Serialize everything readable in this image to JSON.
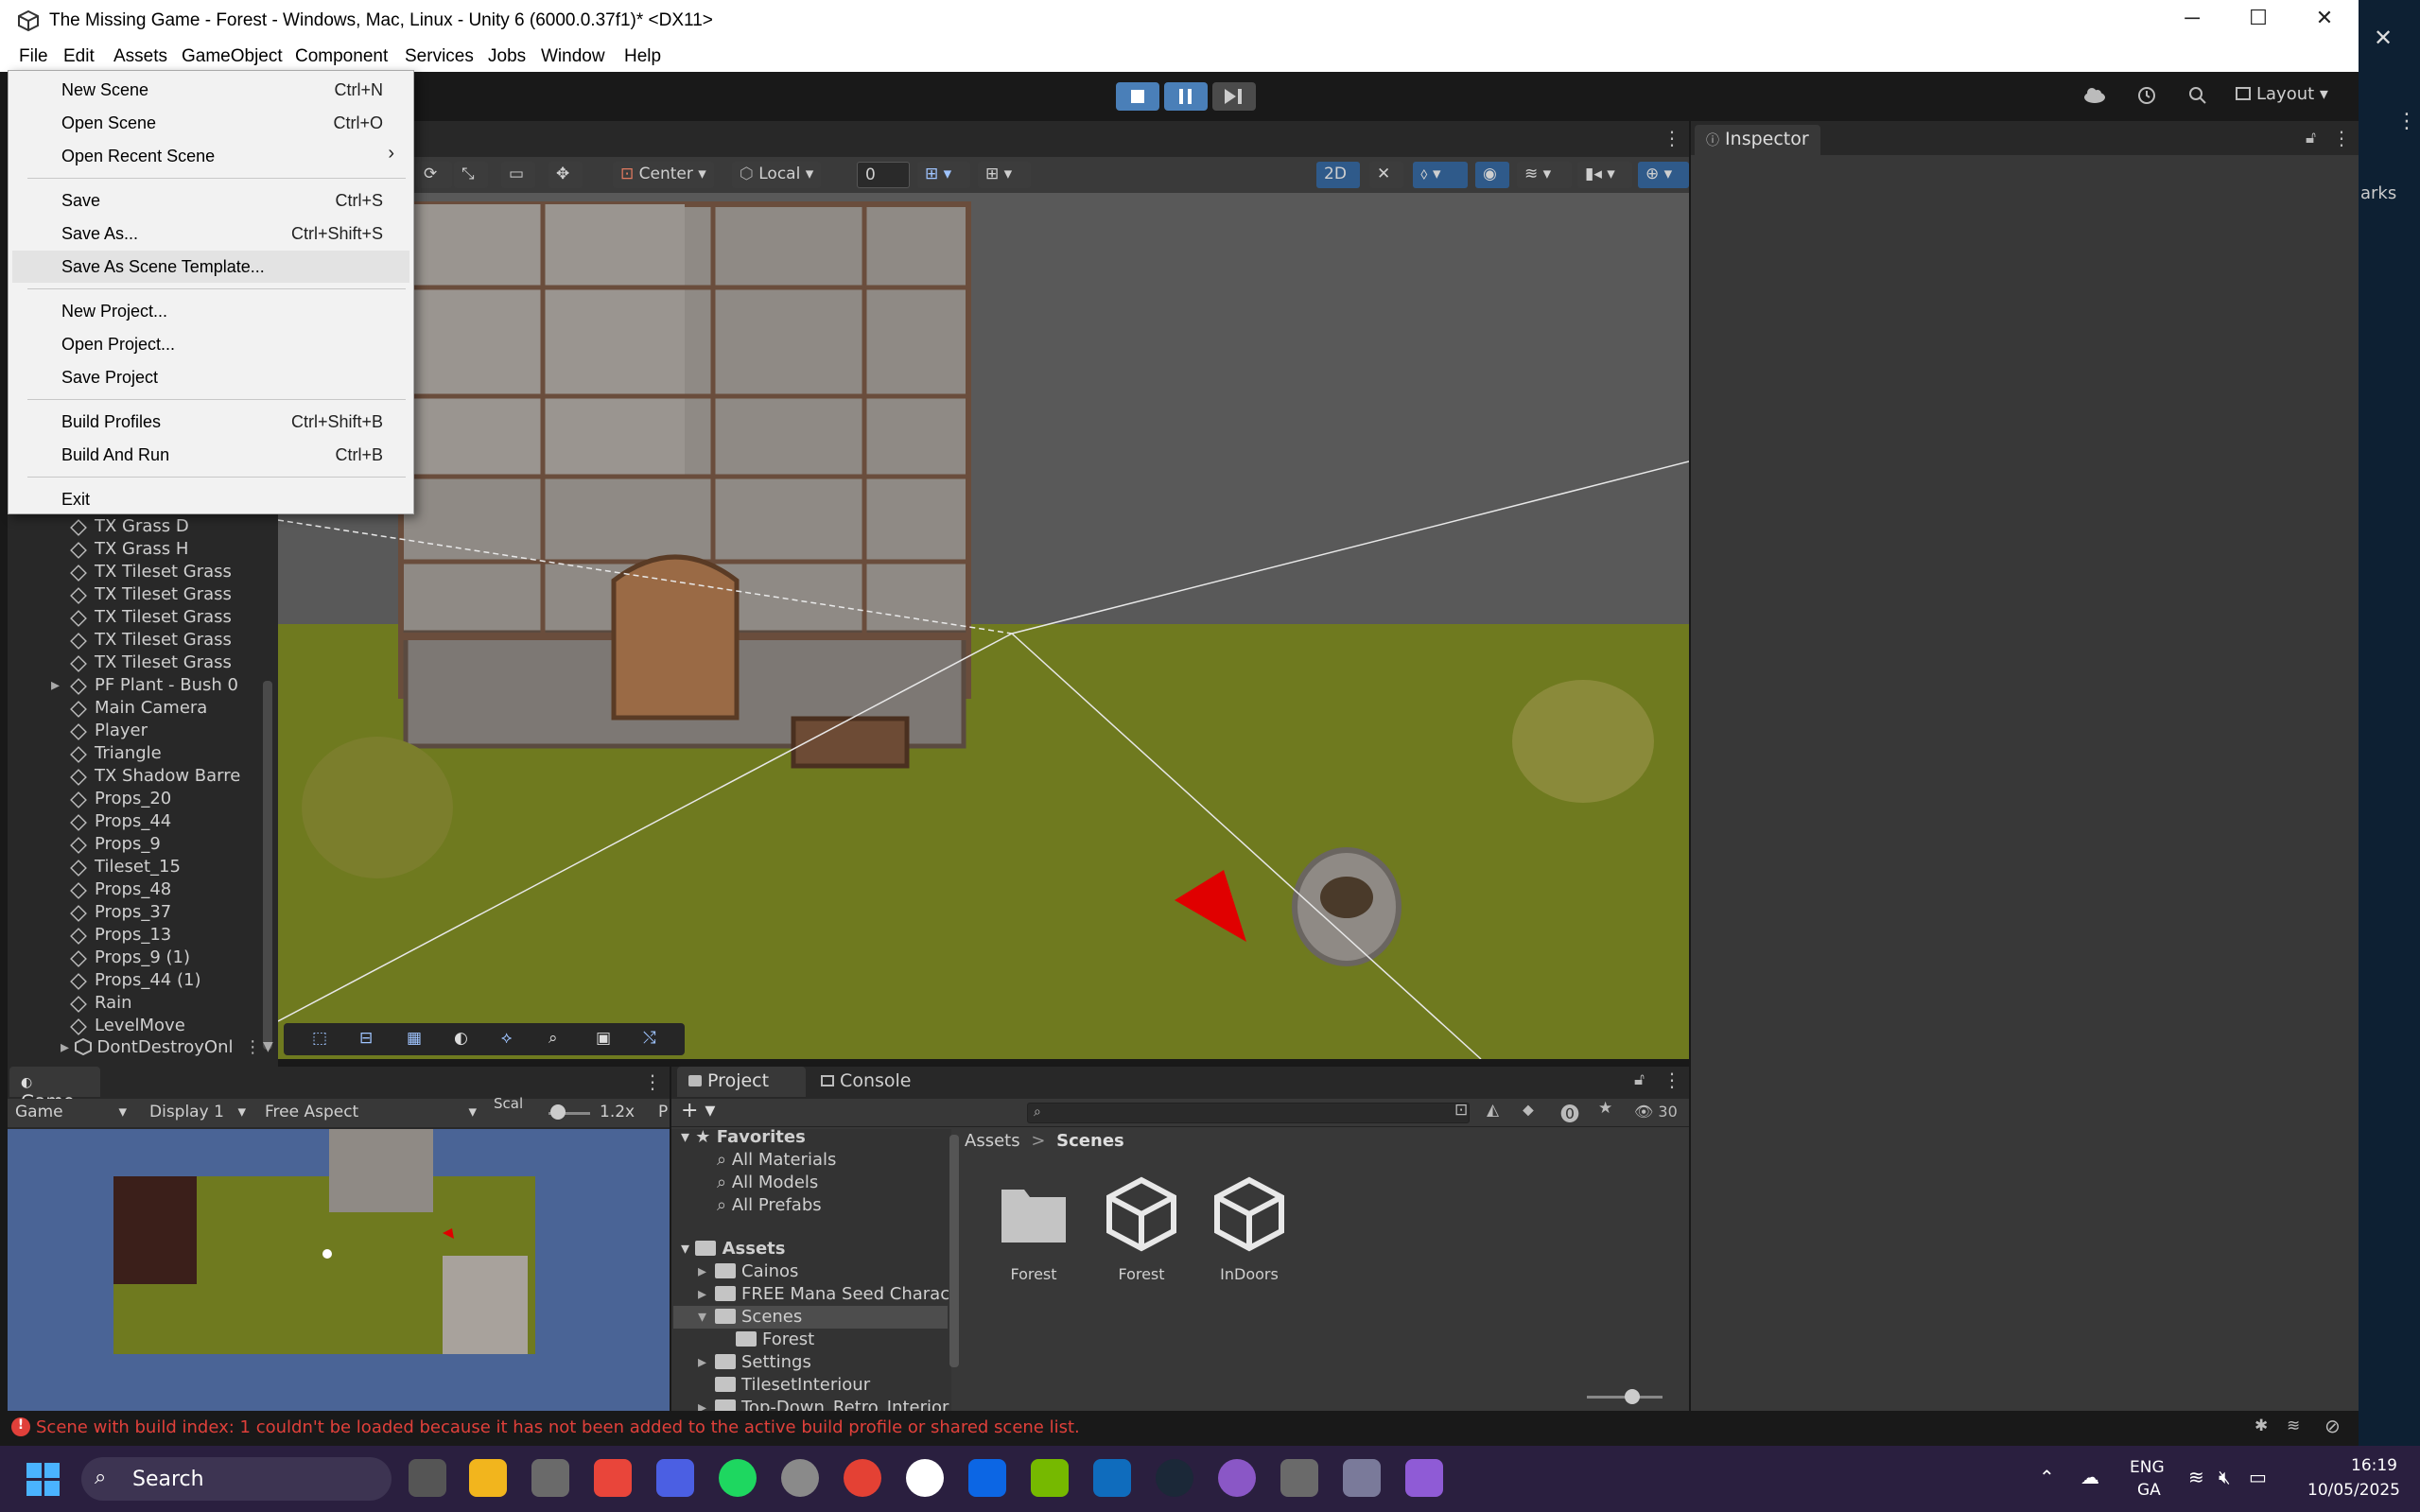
{
  "window": {
    "title": "The Missing Game - Forest - Windows, Mac, Linux - Unity 6 (6000.0.37f1)* <DX11>",
    "minimize": "─",
    "maximize": "☐",
    "close": "✕"
  },
  "menubar": [
    "File",
    "Edit",
    "Assets",
    "GameObject",
    "Component",
    "Services",
    "Jobs",
    "Window",
    "Help"
  ],
  "file_menu": [
    {
      "label": "New Scene",
      "shortcut": "Ctrl+N"
    },
    {
      "label": "Open Scene",
      "shortcut": "Ctrl+O"
    },
    {
      "label": "Open Recent Scene",
      "shortcut": "›"
    },
    {
      "label": "Save",
      "shortcut": "Ctrl+S"
    },
    {
      "label": "Save As...",
      "shortcut": "Ctrl+Shift+S"
    },
    {
      "label": "Save As Scene Template...",
      "shortcut": ""
    },
    {
      "label": "New Project...",
      "shortcut": ""
    },
    {
      "label": "Open Project...",
      "shortcut": ""
    },
    {
      "label": "Save Project",
      "shortcut": ""
    },
    {
      "label": "Build Profiles",
      "shortcut": "Ctrl+Shift+B"
    },
    {
      "label": "Build And Run",
      "shortcut": "Ctrl+B"
    },
    {
      "label": "Exit",
      "shortcut": ""
    }
  ],
  "toolbar": {
    "layout_label": "Layout"
  },
  "scene_toolbar": {
    "pivot": "Center",
    "space": "Local",
    "snap_value": "0",
    "mode_2d": "2D"
  },
  "inspector": {
    "tab": "Inspector"
  },
  "hierarchy": {
    "items": [
      {
        "label": "TX Grass D",
        "expandable": false
      },
      {
        "label": "TX Grass H",
        "expandable": false
      },
      {
        "label": "TX Tileset Grass",
        "expandable": false
      },
      {
        "label": "TX Tileset Grass",
        "expandable": false
      },
      {
        "label": "TX Tileset Grass",
        "expandable": false
      },
      {
        "label": "TX Tileset Grass",
        "expandable": false
      },
      {
        "label": "TX Tileset Grass",
        "expandable": false
      },
      {
        "label": "PF Plant - Bush 0",
        "expandable": true
      },
      {
        "label": "Main Camera",
        "expandable": false
      },
      {
        "label": "Player",
        "expandable": false
      },
      {
        "label": "Triangle",
        "expandable": false
      },
      {
        "label": "TX Shadow Barre",
        "expandable": false
      },
      {
        "label": "Props_20",
        "expandable": false
      },
      {
        "label": "Props_44",
        "expandable": false
      },
      {
        "label": "Props_9",
        "expandable": false
      },
      {
        "label": "Tileset_15",
        "expandable": false
      },
      {
        "label": "Props_48",
        "expandable": false
      },
      {
        "label": "Props_37",
        "expandable": false
      },
      {
        "label": "Props_13",
        "expandable": false
      },
      {
        "label": "Props_9 (1)",
        "expandable": false
      },
      {
        "label": "Props_44 (1)",
        "expandable": false
      },
      {
        "label": "Rain",
        "expandable": false
      },
      {
        "label": "LevelMove",
        "expandable": false
      }
    ],
    "dontdestroy": "DontDestroyOnl"
  },
  "game_view": {
    "tab": "Game",
    "mode": "Game",
    "display": "Display 1",
    "aspect": "Free Aspect",
    "scale_label": "Scal",
    "scale_value": "1.2x",
    "extra": "P"
  },
  "project": {
    "tab_project": "Project",
    "tab_console": "Console",
    "hidden_count": "30",
    "favorites": {
      "label": "Favorites",
      "items": [
        "All Materials",
        "All Models",
        "All Prefabs"
      ]
    },
    "assets_label": "Assets",
    "assets_tree": [
      {
        "label": "Cainos",
        "indent": 1,
        "expandable": true
      },
      {
        "label": "FREE Mana Seed Charact",
        "indent": 1,
        "expandable": true
      },
      {
        "label": "Scenes",
        "indent": 1,
        "expandable": true,
        "selected": true
      },
      {
        "label": "Forest",
        "indent": 2,
        "expandable": false
      },
      {
        "label": "Settings",
        "indent": 1,
        "expandable": true
      },
      {
        "label": "TilesetInteriour",
        "indent": 1,
        "expandable": false
      },
      {
        "label": "Top-Down_Retro_Interior",
        "indent": 1,
        "expandable": true
      }
    ],
    "breadcrumb": [
      "Assets",
      "Scenes"
    ],
    "breadcrumb_sep": ">",
    "grid": [
      {
        "label": "Forest",
        "kind": "folder"
      },
      {
        "label": "Forest",
        "kind": "scene"
      },
      {
        "label": "InDoors",
        "kind": "scene"
      }
    ]
  },
  "status_bar": {
    "message": "Scene with build index: 1 couldn't be loaded because it has not been added to the active build profile or shared scene list."
  },
  "right_edge": {
    "text": "arks"
  },
  "taskbar": {
    "search": "Search",
    "lang_1": "ENG",
    "lang_2": "GA",
    "time": "16:19",
    "date": "10/05/2025"
  },
  "colors": {
    "accent_blue": "#4a7fb8",
    "error_red": "#e0403a",
    "grass": "#6f7a1f",
    "water": "#4a6496",
    "taskbar": "#2a1f3f"
  }
}
